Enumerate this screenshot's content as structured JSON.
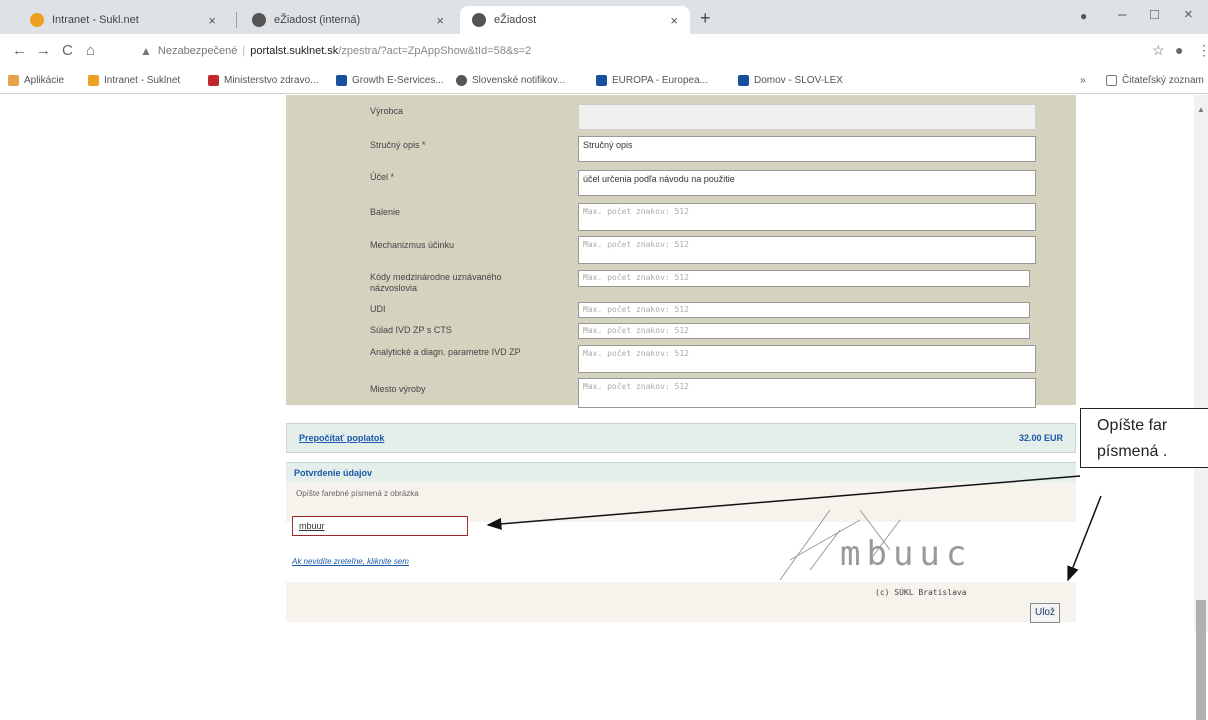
{
  "browser": {
    "tabs": [
      {
        "title": "Intranet - Sukl.net",
        "close": "×"
      },
      {
        "title": "eŽiadost (interná)",
        "close": "×"
      },
      {
        "title": "eŽiadost",
        "close": "×"
      }
    ],
    "new_tab": "+",
    "window_controls": {
      "minimize": "–",
      "maximize": "□",
      "close": "×"
    },
    "nav": {
      "back": "←",
      "forward": "→",
      "reload": "C",
      "home": "⌂"
    },
    "security_label": "Nezabezpečené",
    "url_host": "portalst.suklnet.sk",
    "url_path": "/zpestra/?act=ZpAppShow&tId=58&s=2",
    "bookmarks": [
      {
        "label": "Aplikácie",
        "color": "#e8a34a"
      },
      {
        "label": "Intranet - Suklnet",
        "color": "#f0a020"
      },
      {
        "label": "Ministerstvo zdravo...",
        "color": "#c0282d"
      },
      {
        "label": "Growth E-Services...",
        "color": "#1a4fa0"
      },
      {
        "label": "Slovenské notifikov...",
        "color": "#555555"
      },
      {
        "label": "EUROPA - Europea...",
        "color": "#1a4fa0"
      },
      {
        "label": "Domov - SLOV-LEX",
        "color": "#1a4fa0"
      }
    ],
    "reading_list": "Čitateľský zoznam"
  },
  "form": {
    "rows": [
      {
        "label": "Výrobca",
        "value": "",
        "type": "disabled"
      },
      {
        "label": "Stručný opis *",
        "value": "Stručný opis",
        "type": "text"
      },
      {
        "label": "Účel *",
        "value": "účel určenia podľa návodu na použitie",
        "type": "text"
      },
      {
        "label": "Balenie",
        "value": "Max. počet znakov: 512",
        "type": "placeholder"
      },
      {
        "label": "Mechanizmus účinku",
        "value": "Max. počet znakov: 512",
        "type": "placeholder"
      },
      {
        "label": "Kódy medzinárodne uznávaného názvoslovia",
        "value": "Max. počet znakov: 512",
        "type": "placeholder"
      },
      {
        "label": "UDI",
        "value": "Max. počet znakov: 512",
        "type": "placeholder"
      },
      {
        "label": "Súlad IVD ZP s CTS",
        "value": "Max. počet znakov: 512",
        "type": "placeholder"
      },
      {
        "label": "Analytické a diagn. parametre IVD ZP",
        "value": "Max. počet znakov: 512",
        "type": "placeholder"
      },
      {
        "label": "Miesto výroby",
        "value": "Max. počet znakov: 512",
        "type": "placeholder"
      }
    ],
    "fee_link": "Prepočítať poplatok",
    "fee_amount": "32.00 EUR",
    "confirm_title": "Potvrdenie údajov",
    "captcha_label": "Opíšte farebné písmená z obrázka",
    "captcha_value": "mbuur",
    "captcha_text": "mbuuc",
    "refresh_link": "Ak nevidíte zreteľne, kliknite sem",
    "copyright": "(c) SÚKL Bratislava",
    "save_button": "Ulož"
  },
  "annotation": {
    "callout_text_line1": "Opíšte far",
    "callout_text_line2": "písmená ."
  },
  "colors": {
    "link_blue": "#1a58a8",
    "form_frame": "#d6d2c0",
    "section_bg": "#e4eeea"
  }
}
